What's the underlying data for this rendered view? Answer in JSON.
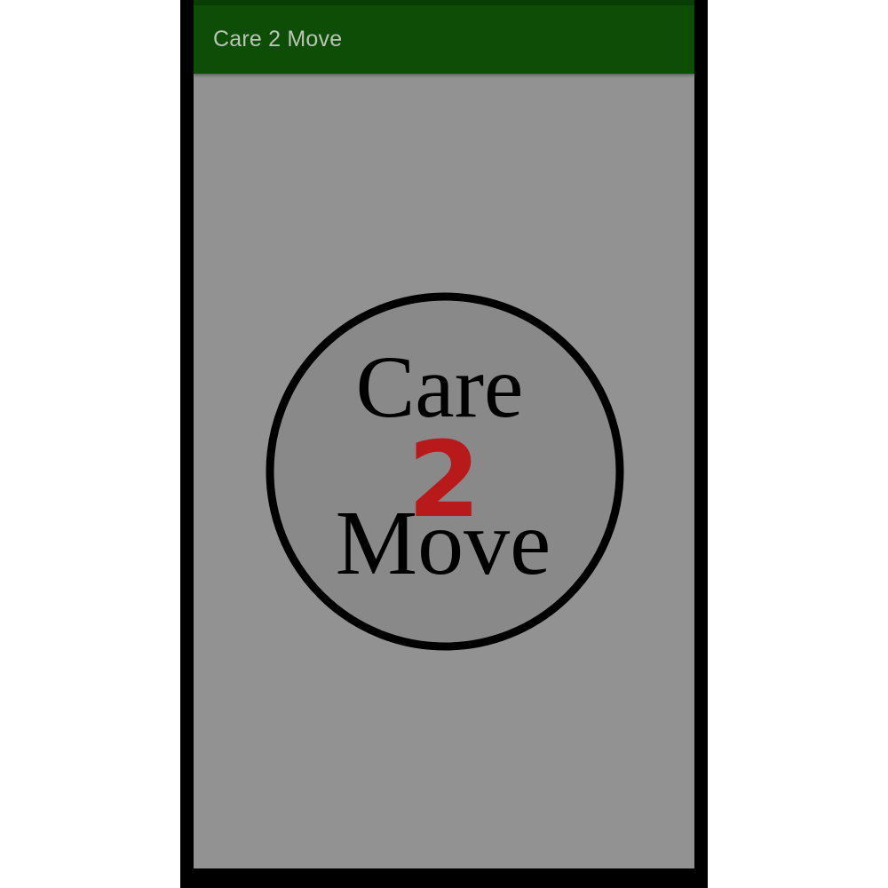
{
  "app_bar": {
    "title": "Care 2 Move"
  },
  "logo": {
    "line1": "Care",
    "line2": "2",
    "line3": "Move",
    "accent_color": "#b8191b"
  },
  "colors": {
    "status_bar": "#083d04",
    "app_bar": "#0e4d05",
    "screen_dimmed": "#929292",
    "device_frame": "#000000"
  }
}
